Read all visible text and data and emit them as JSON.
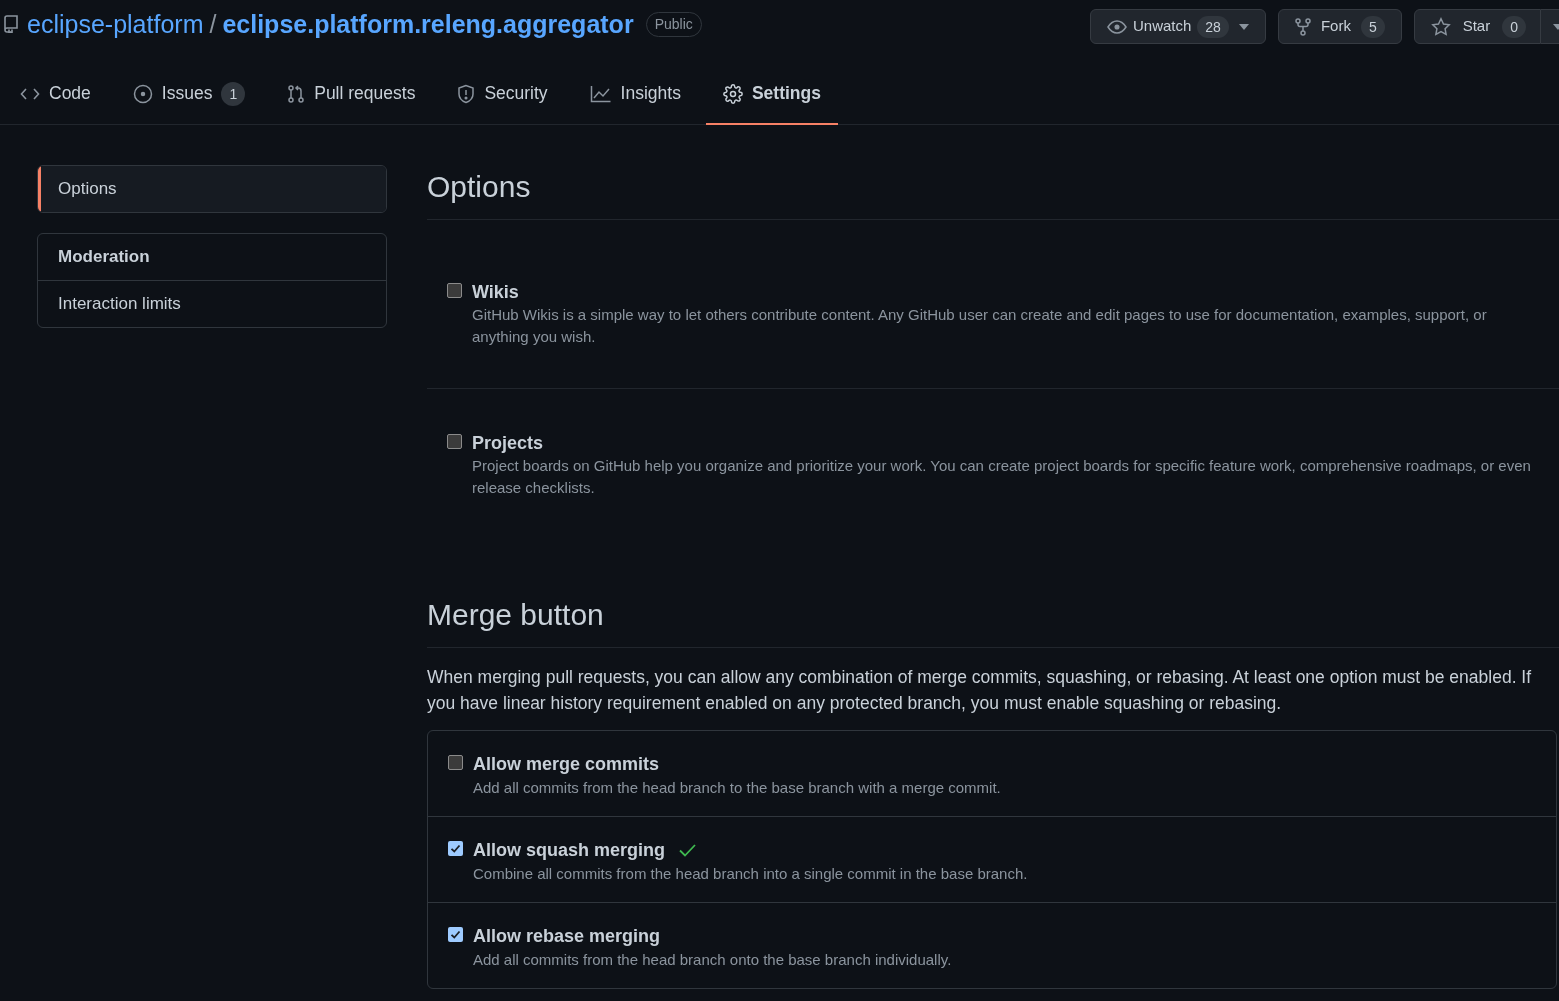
{
  "repo": {
    "owner": "eclipse-platform",
    "separator": "/",
    "name": "eclipse.platform.releng.aggregator",
    "visibility": "Public"
  },
  "actions": [
    {
      "kind": "watch",
      "label": "Unwatch",
      "count": "28"
    },
    {
      "kind": "fork",
      "label": "Fork",
      "count": "5"
    },
    {
      "kind": "star",
      "label": "Star",
      "count": "0"
    }
  ],
  "tabs": [
    {
      "kind": "code",
      "label": "Code",
      "selected": false
    },
    {
      "kind": "issues",
      "label": "Issues",
      "count": "1",
      "selected": false
    },
    {
      "kind": "pulls",
      "label": "Pull requests",
      "selected": false
    },
    {
      "kind": "security",
      "label": "Security",
      "selected": false
    },
    {
      "kind": "insights",
      "label": "Insights",
      "selected": false
    },
    {
      "kind": "settings",
      "label": "Settings",
      "selected": true
    }
  ],
  "sidebar": {
    "groups": [
      {
        "items": [
          {
            "label": "Options",
            "selected": true
          }
        ]
      },
      {
        "heading": "Moderation",
        "items": [
          {
            "label": "Interaction limits",
            "selected": false
          }
        ]
      }
    ]
  },
  "options_section": {
    "title": "Options",
    "features": [
      {
        "label": "Wikis",
        "checked": false,
        "description": "GitHub Wikis is a simple way to let others contribute content. Any GitHub user can create and edit pages to use for documentation, examples, support, or anything you wish."
      },
      {
        "label": "Projects",
        "checked": false,
        "description": "Project boards on GitHub help you organize and prioritize your work. You can create project boards for specific feature work, comprehensive roadmaps, or even release checklists."
      }
    ]
  },
  "merge_section": {
    "title": "Merge button",
    "intro": "When merging pull requests, you can allow any combination of merge commits, squashing, or rebasing. At least one option must be enabled. If you have linear history requirement enabled on any protected branch, you must enable squashing or rebasing.",
    "options": [
      {
        "label": "Allow merge commits",
        "checked": false,
        "saved": false,
        "description": "Add all commits from the head branch to the base branch with a merge commit."
      },
      {
        "label": "Allow squash merging",
        "checked": true,
        "saved": true,
        "description": "Combine all commits from the head branch into a single commit in the base branch."
      },
      {
        "label": "Allow rebase merging",
        "checked": true,
        "saved": false,
        "description": "Add all commits from the head branch onto the base branch individually."
      }
    ]
  }
}
